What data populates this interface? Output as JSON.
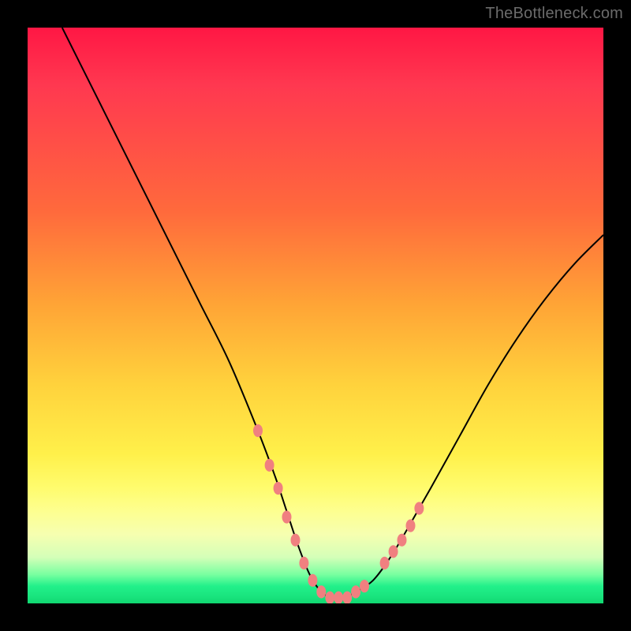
{
  "watermark": "TheBottleneck.com",
  "chart_data": {
    "type": "line",
    "title": "",
    "xlabel": "",
    "ylabel": "",
    "xlim": [
      0,
      100
    ],
    "ylim": [
      0,
      100
    ],
    "grid": false,
    "series": [
      {
        "name": "curve",
        "color": "#000000",
        "x": [
          6,
          10,
          15,
          20,
          25,
          30,
          35,
          40,
          43,
          45,
          47,
          49,
          51,
          53,
          55,
          57,
          60,
          63,
          66,
          70,
          75,
          80,
          85,
          90,
          95,
          100
        ],
        "y": [
          100,
          92,
          82,
          72,
          62,
          52,
          42,
          30,
          22,
          16,
          10,
          5,
          2,
          1,
          1,
          2,
          4,
          8,
          13,
          20,
          29,
          38,
          46,
          53,
          59,
          64
        ]
      }
    ],
    "markers": {
      "name": "dots",
      "color": "#f08080",
      "radius_px": 6,
      "x": [
        40,
        42,
        43.5,
        45,
        46.5,
        48,
        49.5,
        51,
        52.5,
        54,
        55.5,
        57,
        58.5,
        62,
        63.5,
        65,
        66.5,
        68
      ],
      "y": [
        30,
        24,
        20,
        15,
        11,
        7,
        4,
        2,
        1,
        1,
        1,
        2,
        3,
        7,
        9,
        11,
        13.5,
        16.5
      ]
    },
    "background_gradient": {
      "direction": "top_to_bottom",
      "stops": [
        {
          "pct": 0,
          "color": "#ff1744"
        },
        {
          "pct": 32,
          "color": "#ff6a3c"
        },
        {
          "pct": 62,
          "color": "#ffd23c"
        },
        {
          "pct": 84,
          "color": "#fdff90"
        },
        {
          "pct": 95,
          "color": "#78ffa0"
        },
        {
          "pct": 100,
          "color": "#10d770"
        }
      ]
    }
  }
}
